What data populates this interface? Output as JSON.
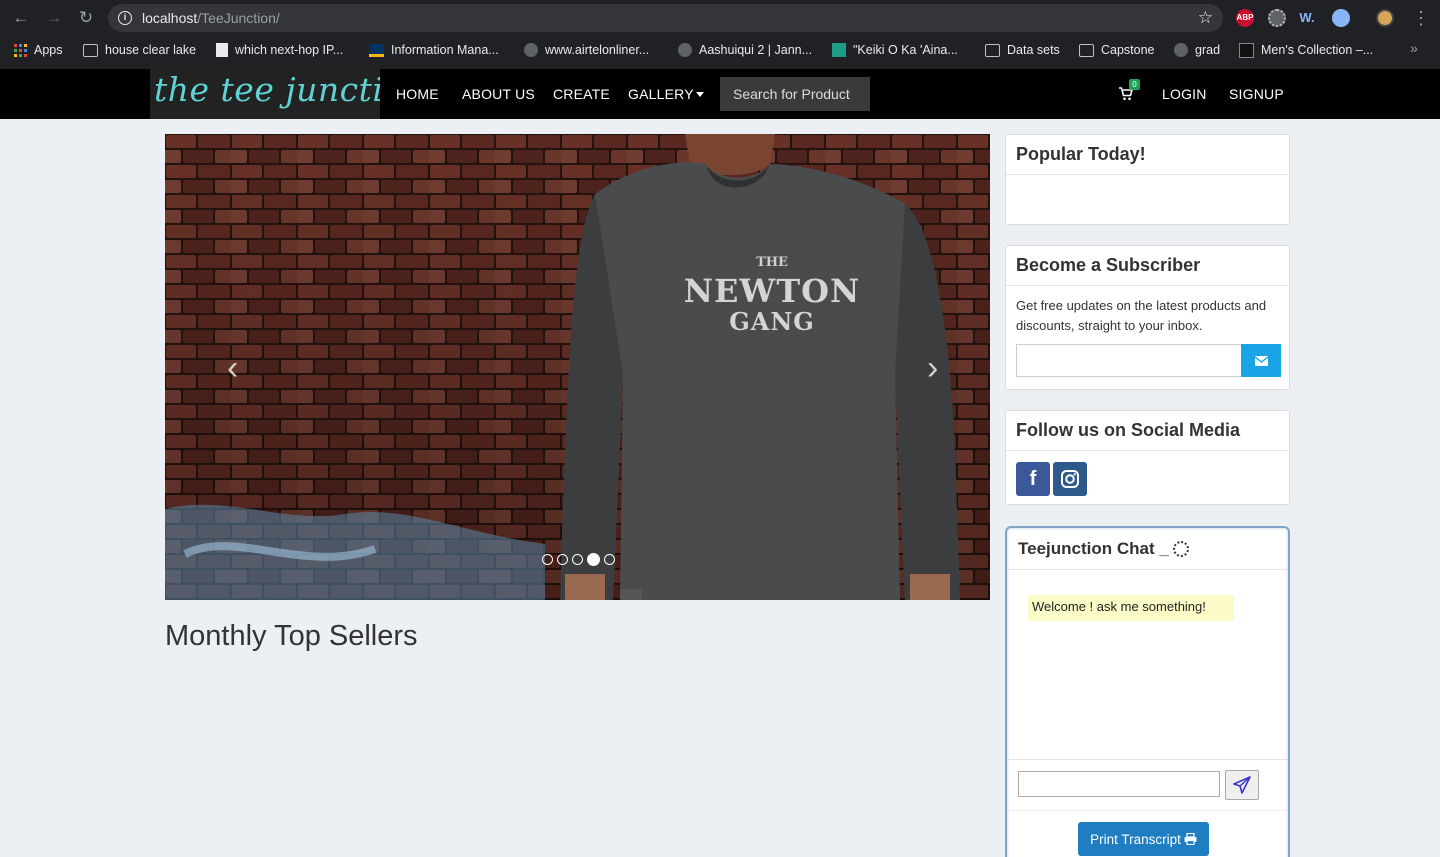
{
  "browser": {
    "url_host": "localhost",
    "url_path": "/TeeJunction/",
    "extensions": [
      "abp-icon",
      "settings-ext-icon",
      "w-ext-icon",
      "blue-ext-icon",
      "profile-avatar"
    ],
    "ext_labels": {
      "abp": "ABP",
      "w": "W."
    },
    "bookmarks": [
      {
        "label": "Apps",
        "icon": "apps-grid-icon"
      },
      {
        "label": "house clear lake",
        "icon": "folder-icon"
      },
      {
        "label": "which next-hop IP...",
        "icon": "page-icon"
      },
      {
        "label": "Information Mana...",
        "icon": "cal-icon"
      },
      {
        "label": "www.airtelonliner...",
        "icon": "globe-icon"
      },
      {
        "label": "Aashuiqui 2 | Jann...",
        "icon": "globe-icon"
      },
      {
        "label": "\"Keiki O Ka 'Aina...",
        "icon": "keiki-icon"
      },
      {
        "label": "Data sets",
        "icon": "folder-icon"
      },
      {
        "label": "Capstone",
        "icon": "folder-icon"
      },
      {
        "label": "grad",
        "icon": "globe-icon"
      },
      {
        "label": "Men's Collection –...",
        "icon": "sr-icon"
      }
    ]
  },
  "site": {
    "logo_text": "the tee junction",
    "nav": {
      "home": "HOME",
      "about": "ABOUT US",
      "create": "CREATE",
      "gallery": "GALLERY",
      "login": "LOGIN",
      "signup": "SIGNUP"
    },
    "search_placeholder": "Search for Product",
    "cart_count": "0"
  },
  "carousel": {
    "shirt_text_top": "THE",
    "shirt_text_main": "NEWTON",
    "shirt_text_sub": "GANG",
    "slide_count": 5,
    "active_slide": 4
  },
  "main": {
    "section_title": "Monthly Top Sellers"
  },
  "sidebar": {
    "popular_title": "Popular Today!",
    "subscriber_title": "Become a Subscriber",
    "subscriber_text": "Get free updates on the latest products and discounts, straight to your inbox.",
    "social_title": "Follow us on Social Media",
    "fb_label": "f"
  },
  "chat": {
    "title": "Teejunction Chat _",
    "welcome": "Welcome ! ask me something!",
    "print_label": "Print Transcript"
  },
  "colors": {
    "accent_cyan": "#5fd3d4",
    "subscribe_button": "#1aa3e6",
    "facebook": "#3b5998",
    "print_button": "#1f7ec1"
  }
}
